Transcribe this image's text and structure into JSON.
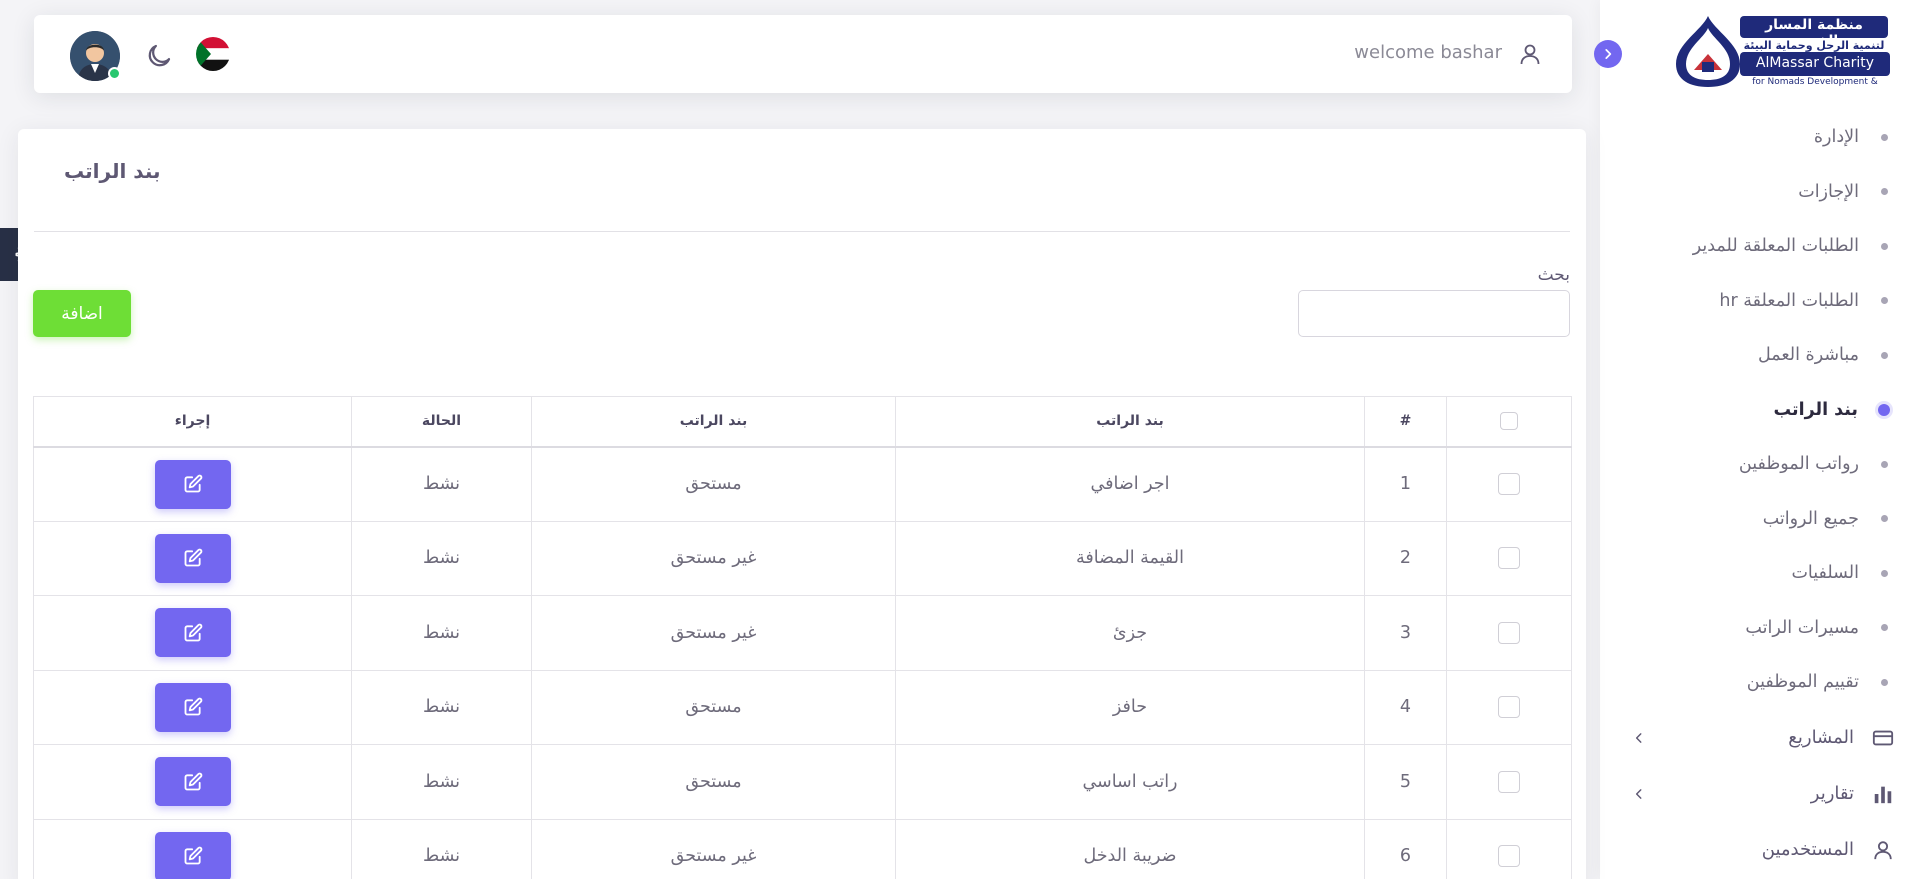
{
  "brand": {
    "line1": "منظمة المسار الخيرية",
    "line2": "لتنمية الرحل وحماية البيئة",
    "line3": "AlMassar Charity",
    "line4": "for Nomads Development &"
  },
  "sidebar": {
    "items": [
      {
        "label": "الإدارة",
        "active": false
      },
      {
        "label": "الإجازات",
        "active": false
      },
      {
        "label": "الطلبات المعلقة للمدير",
        "active": false
      },
      {
        "label": "الطلبات المعلقة hr",
        "active": false
      },
      {
        "label": "مباشرة العمل",
        "active": false
      },
      {
        "label": "بند الراتب",
        "active": true
      },
      {
        "label": "رواتب الموظفين",
        "active": false
      },
      {
        "label": "جميع الرواتب",
        "active": false
      },
      {
        "label": "السلفيات",
        "active": false
      },
      {
        "label": "مسيرات الراتب",
        "active": false
      },
      {
        "label": "تقييم الموظفين",
        "active": false
      }
    ],
    "groups": [
      {
        "label": "المشاريع",
        "icon": "credit-card-icon"
      },
      {
        "label": "تقارير",
        "icon": "bar-chart-icon"
      },
      {
        "label": "المستخدمين",
        "icon": "user-icon"
      }
    ]
  },
  "header": {
    "welcome": "welcome bashar"
  },
  "page": {
    "title": "بند الراتب",
    "search_label": "بحث",
    "add_label": "اضافة"
  },
  "table": {
    "headers": [
      "#",
      "بند الراتب",
      "بند الراتب",
      "الحالة",
      "إجراء"
    ],
    "rows": [
      {
        "num": "1",
        "item": "اجر اضافي",
        "type": "مستحق",
        "status": "نشط"
      },
      {
        "num": "2",
        "item": "القيمة المضافة",
        "type": "غير مستحق",
        "status": "نشط"
      },
      {
        "num": "3",
        "item": "جزئ",
        "type": "غير مستحق",
        "status": "نشط"
      },
      {
        "num": "4",
        "item": "حافز",
        "type": "مستحق",
        "status": "نشط"
      },
      {
        "num": "5",
        "item": "راتب اساسي",
        "type": "مستحق",
        "status": "نشط"
      },
      {
        "num": "6",
        "item": "ضريبة الدخل",
        "type": "غير مستحق",
        "status": "نشط"
      }
    ]
  },
  "colors": {
    "primary": "#7367f0",
    "success": "#6ede36",
    "dark": "#283046"
  }
}
